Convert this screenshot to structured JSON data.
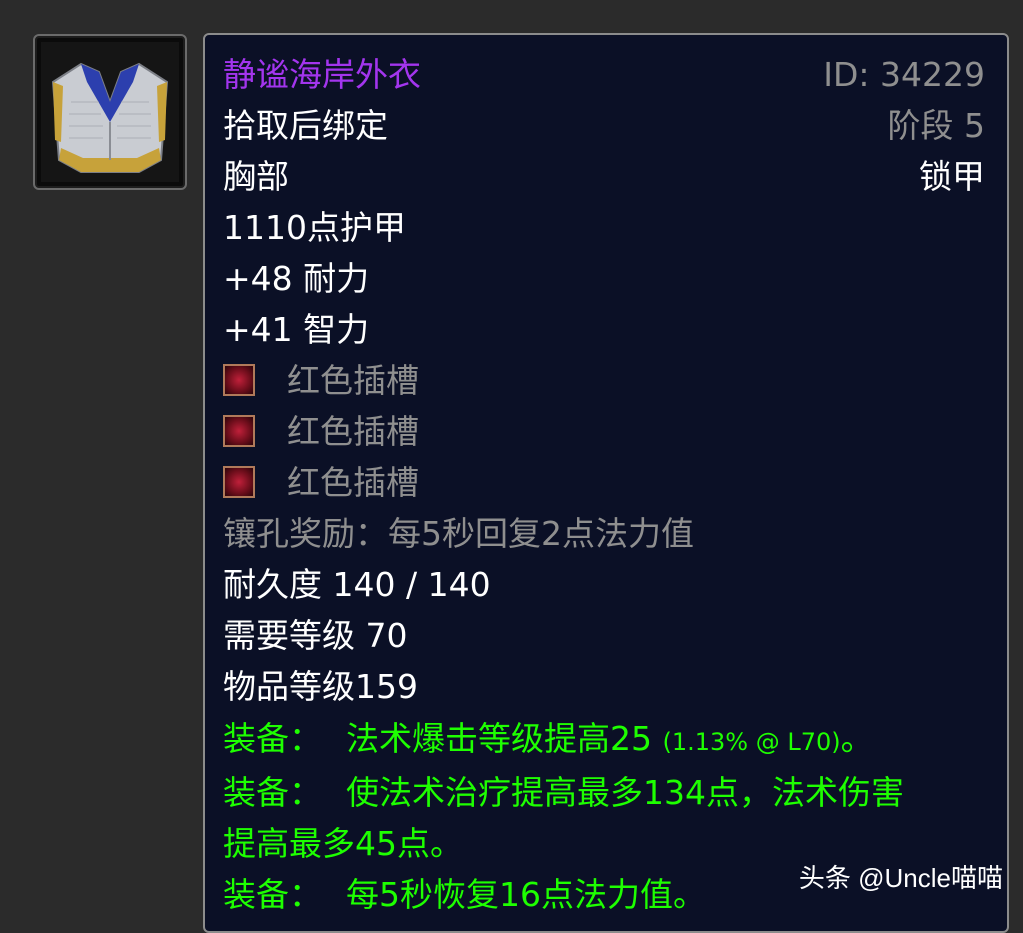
{
  "item": {
    "name": "静谧海岸外衣",
    "id_label": "ID: 34229",
    "binding": "拾取后绑定",
    "phase": "阶段 5",
    "slot": "胸部",
    "armor_type": "锁甲",
    "armor": "1110点护甲",
    "stats": [
      "+48 耐力",
      "+41 智力"
    ],
    "sockets": [
      "红色插槽",
      "红色插槽",
      "红色插槽"
    ],
    "socket_bonus": "镶孔奖励：每5秒回复2点法力值",
    "durability": "耐久度 140 / 140",
    "required_level": "需要等级 70",
    "item_level": "物品等级159",
    "equip": [
      {
        "prefix": "装备：",
        "text": "法术爆击等级提高25",
        "extra": "(1.13% @ L70)",
        "suffix": "。"
      },
      {
        "prefix": "装备：",
        "text": "使法术治疗提高最多134点，法术伤害",
        "text2": "提高最多45点。"
      },
      {
        "prefix": "装备：",
        "text": "每5秒恢复16点法力值。"
      }
    ]
  },
  "watermark": "头条 @Uncle喵喵",
  "colors": {
    "epic": "#a335ee",
    "uncommon_green": "#1eff00",
    "grey": "#8f8f8f",
    "tooltip_bg": "#0b1026"
  },
  "icons": {
    "item_icon": "mail-chest-armor-icon",
    "socket_icon": "red-socket-icon"
  }
}
